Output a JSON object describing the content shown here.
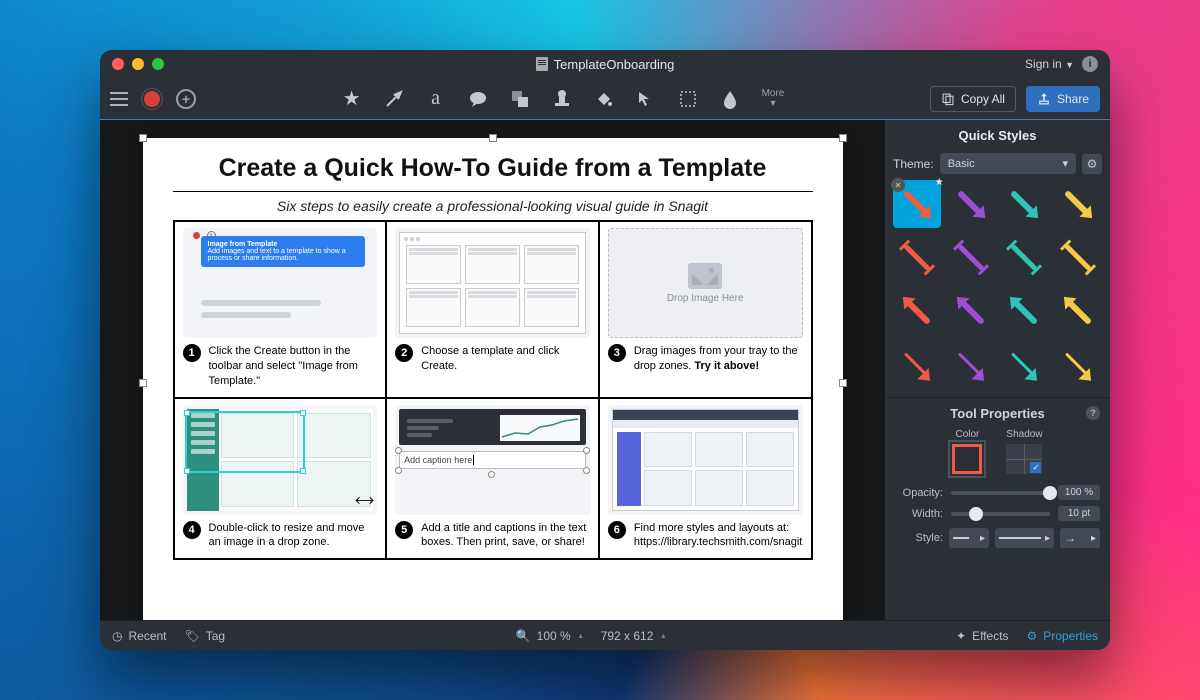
{
  "titlebar": {
    "filename": "TemplateOnboarding",
    "signin": "Sign in"
  },
  "toolbar": {
    "more": "More",
    "copy_all": "Copy All",
    "share": "Share"
  },
  "document": {
    "title": "Create a Quick How-To Guide from a Template",
    "subtitle": "Six steps to easily create a professional-looking visual guide in Snagit",
    "steps": {
      "s1": "Click the Create button in the toolbar and select \"Image from Template.\"",
      "s1_tip_title": "Image from Template",
      "s1_tip_body": "Add images and text to a template to show a process or share information.",
      "s2": "Choose a template and click Create.",
      "s3a": "Drag images from your tray to the drop zones. ",
      "s3b": "Try it above!",
      "s3_drop": "Drop Image Here",
      "s4": "Double-click to resize and move an image in a drop zone.",
      "s5": "Add a title and captions in the text boxes. Then print, save, or share!",
      "s5_caption": "Add caption here",
      "s6": "Find more styles and layouts at: https://library.techsmith.com/snagit"
    }
  },
  "sidebar": {
    "quick_styles": "Quick Styles",
    "theme_label": "Theme:",
    "theme_value": "Basic",
    "tool_properties": "Tool Properties",
    "color_label": "Color",
    "shadow_label": "Shadow",
    "opacity_label": "Opacity:",
    "opacity_value": "100 %",
    "width_label": "Width:",
    "width_value": "10 pt",
    "style_label": "Style:"
  },
  "statusbar": {
    "recent": "Recent",
    "tag": "Tag",
    "zoom": "100 %",
    "dims": "792 x 612",
    "effects": "Effects",
    "properties": "Properties"
  }
}
